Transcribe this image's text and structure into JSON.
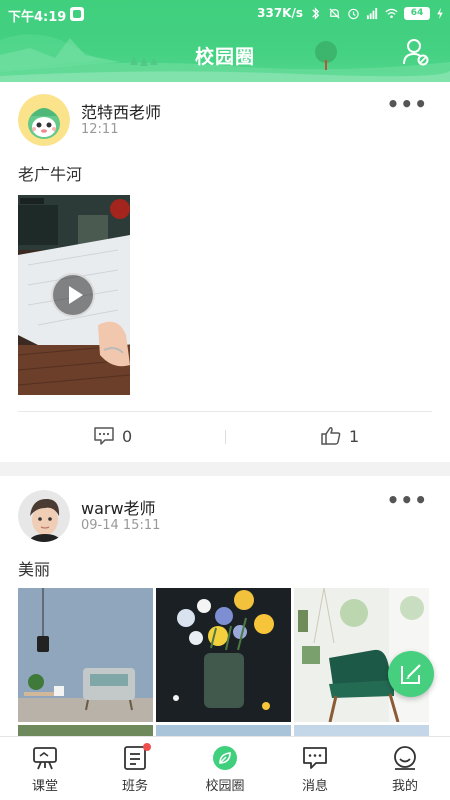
{
  "status_bar": {
    "time": "下午4:19",
    "network_speed": "337K/s",
    "battery": "64"
  },
  "header": {
    "title": "校园圈"
  },
  "posts": [
    {
      "author": "范特西老师",
      "time": "12:11",
      "content": "老广牛河",
      "media_type": "video",
      "comments": "0",
      "likes": "1"
    },
    {
      "author": "warw老师",
      "time": "09-14 15:11",
      "content": "美丽",
      "media_type": "images"
    }
  ],
  "bottom_nav": [
    {
      "label": "课堂",
      "icon": "classroom-icon"
    },
    {
      "label": "班务",
      "icon": "class-affairs-icon"
    },
    {
      "label": "校园圈",
      "icon": "campus-circle-icon"
    },
    {
      "label": "消息",
      "icon": "message-icon"
    },
    {
      "label": "我的",
      "icon": "profile-icon"
    }
  ],
  "colors": {
    "brand_green": "#3fcf7d",
    "badge_red": "#f04d4d"
  }
}
